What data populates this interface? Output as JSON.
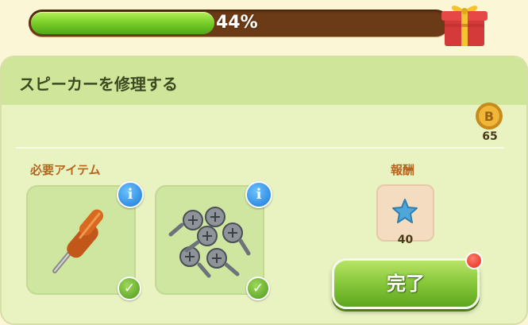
{
  "progress": {
    "percent_label": "44%",
    "fraction": 0.44
  },
  "panel": {
    "title": "スピーカーを修理する",
    "coin_count": "65"
  },
  "required_items": {
    "label": "必要アイテム",
    "items": [
      {
        "name": "screwdriver",
        "info": "i",
        "check": "✓"
      },
      {
        "name": "screws",
        "info": "i",
        "check": "✓"
      }
    ]
  },
  "reward": {
    "label": "報酬",
    "count": "40",
    "icon": "blue-star-icon"
  },
  "complete_button": {
    "label": "完了"
  },
  "colors": {
    "progress_fill": "#7dd12b",
    "progress_track": "#6b3a16",
    "panel_bg": "#e9f3c2",
    "button_green": "#86c73a",
    "section_label": "#b5651d"
  }
}
